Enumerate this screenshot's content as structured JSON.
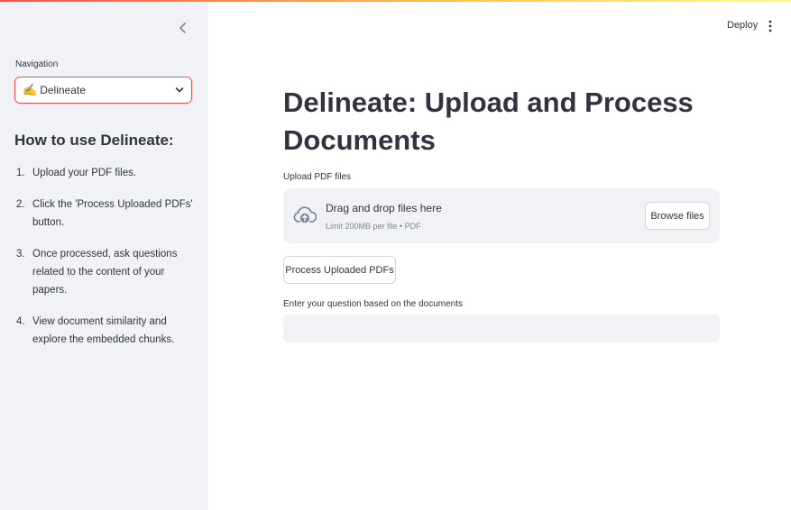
{
  "sidebar": {
    "collapse_icon": "chevron-left-icon",
    "nav_label": "Navigation",
    "nav_select": {
      "emoji": "✍️",
      "value": "Delineate",
      "icon": "chevron-down-icon"
    },
    "howto_title": "How to use Delineate:",
    "steps": [
      {
        "num": "1.",
        "text": "Upload your PDF files."
      },
      {
        "num": "2.",
        "text": "Click the 'Process Uploaded PDFs' button."
      },
      {
        "num": "3.",
        "text": "Once processed, ask questions related to the content of your papers."
      },
      {
        "num": "4.",
        "text": "View document similarity and explore the embedded chunks."
      }
    ]
  },
  "header": {
    "deploy_label": "Deploy",
    "menu_icon": "kebab-menu-icon"
  },
  "main": {
    "title": "Delineate: Upload and Process Documents",
    "uploader": {
      "label": "Upload PDF files",
      "icon": "cloud-upload-icon",
      "drop_text": "Drag and drop files here",
      "limit_text": "Limit 200MB per file • PDF",
      "browse_label": "Browse files"
    },
    "process_button_label": "Process Uploaded PDFs",
    "question": {
      "label": "Enter your question based on the documents",
      "value": "",
      "placeholder": ""
    }
  },
  "colors": {
    "accent": "#ff4b4b",
    "sidebar_bg": "#f0f2f6",
    "text": "#31333f",
    "muted": "#808495"
  }
}
